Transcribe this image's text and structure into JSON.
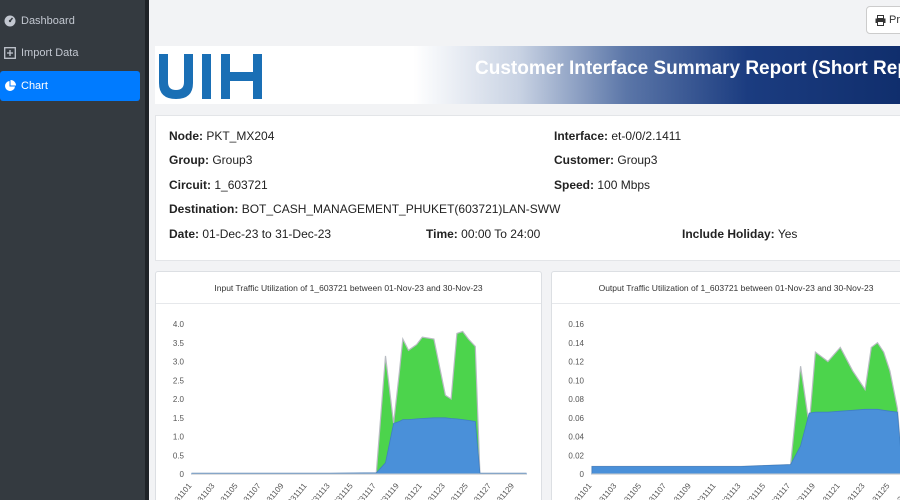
{
  "sidebar": {
    "items": [
      {
        "label": "Dashboard",
        "icon": "gauge-icon",
        "active": false
      },
      {
        "label": "Import Data",
        "icon": "plus-square-icon",
        "active": false
      },
      {
        "label": "Chart",
        "icon": "pie-chart-icon",
        "active": true
      }
    ]
  },
  "toolbar": {
    "print_label": "Pri"
  },
  "banner": {
    "logo_text": "UIH",
    "title": "Customer Interface Summary Report (Short Rep"
  },
  "info": {
    "node_label": "Node:",
    "node_value": "PKT_MX204",
    "group_label": "Group:",
    "group_value": "Group3",
    "circuit_label": "Circuit:",
    "circuit_value": "1_603721",
    "destination_label": "Destination:",
    "destination_value": "BOT_CASH_MANAGEMENT_PHUKET(603721)LAN-SWW",
    "date_label": "Date:",
    "date_value": "01-Dec-23 to 31-Dec-23",
    "time_label": "Time:",
    "time_value": "00:00 To 24:00",
    "interface_label": "Interface:",
    "interface_value": "et-0/0/2.1411",
    "customer_label": "Customer:",
    "customer_value": "Group3",
    "speed_label": "Speed:",
    "speed_value": "100 Mbps",
    "holiday_label": "Include Holiday:",
    "holiday_value": "Yes"
  },
  "colors": {
    "accent": "#007bff",
    "green": "#4cd44c",
    "blue": "#4a90d9",
    "sidebar": "#343a40"
  },
  "chart_data": [
    {
      "type": "area",
      "title": "Input Traffic Utilization of 1_603721 between 01-Nov-23 and 30-Nov-23",
      "ylim": [
        0,
        4.0
      ],
      "yticks": [
        "0",
        "0.5",
        "1.0",
        "1.5",
        "2.0",
        "2.5",
        "3.0",
        "3.5",
        "4.0"
      ],
      "xticks": [
        "20231101",
        "20231103",
        "20231105",
        "20231107",
        "20231109",
        "20231111",
        "20231113",
        "20231115",
        "20231117",
        "20231119",
        "20231121",
        "20231123",
        "20231125",
        "20231127",
        "20231129"
      ],
      "x": [
        0,
        4,
        8,
        12,
        16,
        16.8,
        17.5,
        18,
        18.3,
        18.8,
        19.5,
        20,
        21,
        22,
        22.5,
        23,
        23.5,
        24,
        24.6,
        25,
        26,
        27,
        28,
        29
      ],
      "series": [
        {
          "values": [
            0.02,
            0.02,
            0.02,
            0.02,
            0.03,
            3.15,
            1.35,
            2.7,
            3.6,
            3.3,
            3.45,
            3.65,
            3.6,
            2.1,
            2.0,
            3.75,
            3.8,
            3.6,
            3.4,
            0.02,
            0.02,
            0.02,
            0.02,
            0.02
          ]
        },
        {
          "values": [
            0.02,
            0.02,
            0.02,
            0.02,
            0.03,
            0.3,
            1.35,
            1.4,
            1.45,
            1.45,
            1.47,
            1.48,
            1.5,
            1.5,
            1.48,
            1.47,
            1.45,
            1.43,
            1.4,
            0.02,
            0.02,
            0.02,
            0.02,
            0.02
          ]
        }
      ]
    },
    {
      "type": "area",
      "title": "Output Traffic Utilization of 1_603721 between 01-Nov-23 and 30-Nov-23",
      "ylim": [
        0,
        0.16
      ],
      "yticks": [
        "0",
        "0.02",
        "0.04",
        "0.06",
        "0.08",
        "0.10",
        "0.12",
        "0.14",
        "0.16"
      ],
      "xticks": [
        "20231101",
        "20231103",
        "20231105",
        "20231107",
        "20231109",
        "20231111",
        "20231113",
        "20231115",
        "20231117",
        "20231119",
        "20231121",
        "20231123",
        "20231125",
        "20231127",
        "20231129"
      ],
      "x": [
        0,
        4,
        8,
        12,
        16,
        16.8,
        17.5,
        18,
        18.5,
        19,
        20,
        21,
        22,
        22.5,
        23,
        23.5,
        24,
        24.6,
        25,
        26,
        27,
        28,
        29
      ],
      "series": [
        {
          "values": [
            0.008,
            0.008,
            0.008,
            0.008,
            0.01,
            0.115,
            0.052,
            0.13,
            0.125,
            0.12,
            0.135,
            0.11,
            0.09,
            0.135,
            0.14,
            0.13,
            0.11,
            0.07,
            0.005,
            0.007,
            0.009,
            0.008,
            0.01
          ]
        },
        {
          "values": [
            0.008,
            0.008,
            0.008,
            0.008,
            0.01,
            0.03,
            0.065,
            0.066,
            0.066,
            0.066,
            0.067,
            0.068,
            0.069,
            0.069,
            0.069,
            0.068,
            0.067,
            0.066,
            0.005,
            0.007,
            0.009,
            0.008,
            0.01
          ]
        }
      ]
    }
  ]
}
